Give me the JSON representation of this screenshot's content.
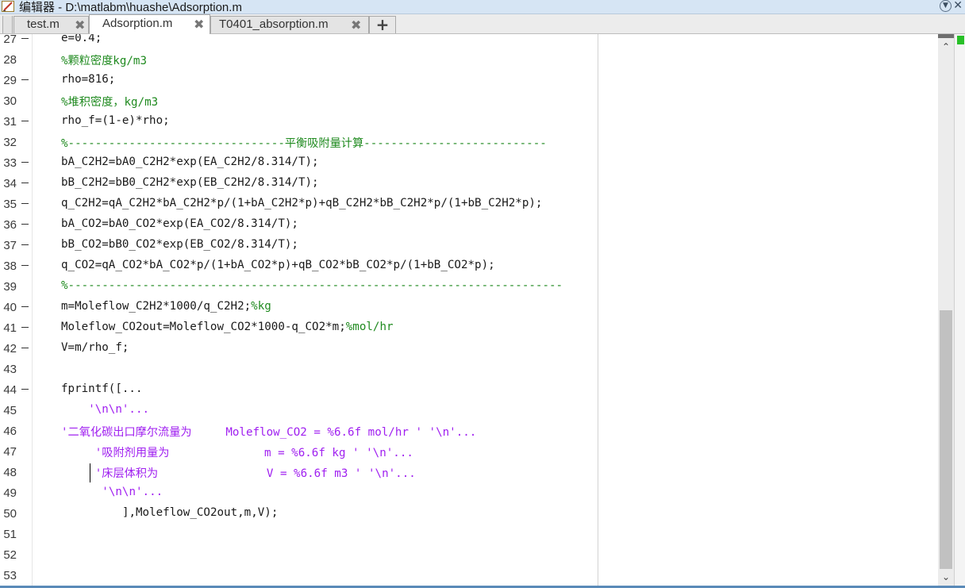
{
  "window": {
    "title": "编辑器 - D:\\matlabm\\huashe\\Adsorption.m"
  },
  "tabs": [
    {
      "label": "test.m",
      "active": false
    },
    {
      "label": "Adsorption.m",
      "active": true
    },
    {
      "label": "T0401_absorption.m",
      "active": false
    }
  ],
  "tab_close_glyph": "✖",
  "tab_add_glyph": "+",
  "scroll": {
    "up_glyph": "⌃",
    "down_glyph": "⌄"
  },
  "editor": {
    "lines": [
      {
        "num": "27",
        "bp": true,
        "indent": 0,
        "segs": [
          {
            "t": "e=0.4;",
            "c": "black"
          }
        ]
      },
      {
        "num": "28",
        "bp": false,
        "indent": 0,
        "segs": [
          {
            "t": "%颗粒密度kg/m3",
            "c": "green"
          }
        ]
      },
      {
        "num": "29",
        "bp": true,
        "indent": 0,
        "segs": [
          {
            "t": "rho=816;",
            "c": "black"
          }
        ]
      },
      {
        "num": "30",
        "bp": false,
        "indent": 0,
        "segs": [
          {
            "t": "%堆积密度，kg/m3",
            "c": "green"
          }
        ]
      },
      {
        "num": "31",
        "bp": true,
        "indent": 0,
        "segs": [
          {
            "t": "rho_f=(1-e)*rho;",
            "c": "black"
          }
        ]
      },
      {
        "num": "32",
        "bp": false,
        "indent": 0,
        "segs": [
          {
            "t": "%--------------------------------平衡吸附量计算---------------------------",
            "c": "green"
          }
        ]
      },
      {
        "num": "33",
        "bp": true,
        "indent": 0,
        "segs": [
          {
            "t": "bA_C2H2=bA0_C2H2*exp(EA_C2H2/8.314/T);",
            "c": "black"
          }
        ]
      },
      {
        "num": "34",
        "bp": true,
        "indent": 0,
        "segs": [
          {
            "t": "bB_C2H2=bB0_C2H2*exp(EB_C2H2/8.314/T);",
            "c": "black"
          }
        ]
      },
      {
        "num": "35",
        "bp": true,
        "indent": 0,
        "segs": [
          {
            "t": "q_C2H2=qA_C2H2*bA_C2H2*p/(1+bA_C2H2*p)+qB_C2H2*bB_C2H2*p/(1+bB_C2H2*p);",
            "c": "black"
          }
        ]
      },
      {
        "num": "36",
        "bp": true,
        "indent": 0,
        "segs": [
          {
            "t": "bA_CO2=bA0_CO2*exp(EA_CO2/8.314/T);",
            "c": "black"
          }
        ]
      },
      {
        "num": "37",
        "bp": true,
        "indent": 0,
        "segs": [
          {
            "t": "bB_CO2=bB0_CO2*exp(EB_CO2/8.314/T);",
            "c": "black"
          }
        ]
      },
      {
        "num": "38",
        "bp": true,
        "indent": 0,
        "segs": [
          {
            "t": "q_CO2=qA_CO2*bA_CO2*p/(1+bA_CO2*p)+qB_CO2*bB_CO2*p/(1+bB_CO2*p);",
            "c": "black"
          }
        ]
      },
      {
        "num": "39",
        "bp": false,
        "indent": 0,
        "segs": [
          {
            "t": "%-------------------------------------------------------------------------",
            "c": "green"
          }
        ]
      },
      {
        "num": "40",
        "bp": true,
        "indent": 0,
        "segs": [
          {
            "t": "m=Moleflow_C2H2*1000/q_C2H2;",
            "c": "black"
          },
          {
            "t": "%kg",
            "c": "green"
          }
        ]
      },
      {
        "num": "41",
        "bp": true,
        "indent": 0,
        "segs": [
          {
            "t": "Moleflow_CO2out=Moleflow_CO2*1000-q_CO2*m;",
            "c": "black"
          },
          {
            "t": "%mol/hr",
            "c": "green"
          }
        ]
      },
      {
        "num": "42",
        "bp": true,
        "indent": 0,
        "segs": [
          {
            "t": "V=m/rho_f;",
            "c": "black"
          }
        ]
      },
      {
        "num": "43",
        "bp": false,
        "indent": 0,
        "segs": []
      },
      {
        "num": "44",
        "bp": true,
        "indent": 0,
        "segs": [
          {
            "t": "fprintf([...",
            "c": "black"
          }
        ]
      },
      {
        "num": "45",
        "bp": false,
        "indent": 4,
        "segs": [
          {
            "t": "'\\n\\n'...",
            "c": "purple"
          }
        ]
      },
      {
        "num": "46",
        "bp": false,
        "indent": 0,
        "segs": [
          {
            "t": "'二氧化碳出口摩尔流量为     Moleflow_CO2 = %6.6f mol/hr ' '\\n'...",
            "c": "purple"
          }
        ]
      },
      {
        "num": "47",
        "bp": false,
        "indent": 5,
        "segs": [
          {
            "t": "'吸附剂用量为              m = %6.6f kg ' '\\n'...",
            "c": "purple"
          }
        ]
      },
      {
        "num": "48",
        "bp": false,
        "indent": 5,
        "segs": [
          {
            "t": "'床层体积为                V = %6.6f m3 ' '\\n'...",
            "c": "purple"
          }
        ]
      },
      {
        "num": "49",
        "bp": false,
        "indent": 6,
        "segs": [
          {
            "t": "'\\n\\n'...",
            "c": "purple"
          }
        ]
      },
      {
        "num": "50",
        "bp": false,
        "indent": 9,
        "segs": [
          {
            "t": "],Moleflow_CO2out,m,V);",
            "c": "black"
          }
        ]
      },
      {
        "num": "51",
        "bp": false,
        "indent": 0,
        "segs": []
      },
      {
        "num": "52",
        "bp": false,
        "indent": 0,
        "segs": []
      },
      {
        "num": "53",
        "bp": false,
        "indent": 0,
        "segs": []
      }
    ]
  },
  "colors": {
    "keyword_black": "#1a1a1a",
    "comment_green": "#1f8a1f",
    "string_purple": "#a020f0",
    "code_ok_indicator": "#27c027"
  },
  "icons": {
    "title": "matlab-editor-icon",
    "title_menu": "chevron-down-circle-icon",
    "title_close": "close-icon"
  }
}
